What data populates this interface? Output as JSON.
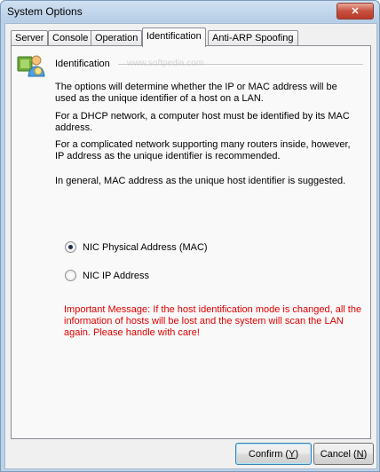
{
  "window": {
    "title": "System Options",
    "close_label": "✕"
  },
  "tabs": [
    {
      "label": "Server"
    },
    {
      "label": "Console"
    },
    {
      "label": "Operation"
    },
    {
      "label": "Identification"
    },
    {
      "label": "Anti-ARP Spoofing"
    }
  ],
  "active_tab": "Identification",
  "section": {
    "title": "Identification",
    "icon": "users-icon"
  },
  "paragraphs": [
    "The options will determine whether the IP or MAC address will be used as the unique identifier of a host on a LAN.",
    "For a DHCP network, a computer host must be identified by its MAC address.",
    "For a complicated network supporting many routers inside, however, IP address as the unique identifier is recommended.",
    "In general, MAC address as the unique host identifier is suggested."
  ],
  "options": {
    "mac": {
      "label": "NIC Physical Address (MAC)",
      "checked": true
    },
    "ip": {
      "label": "NIC IP Address",
      "checked": false
    }
  },
  "warning": "Important Message: If the host identification mode is changed, all the information of hosts will be lost and the system will scan the LAN again. Please handle with care!",
  "buttons": {
    "confirm": {
      "text": "Confirm (",
      "key": "Y",
      "close": ")"
    },
    "cancel": {
      "text": "Cancel (",
      "key": "N",
      "close": ")"
    }
  },
  "watermark": "www.softpedia.com",
  "colors": {
    "warning": "#e00000",
    "titlebar": "#b9d1ea",
    "panel": "#f9f9f9"
  }
}
